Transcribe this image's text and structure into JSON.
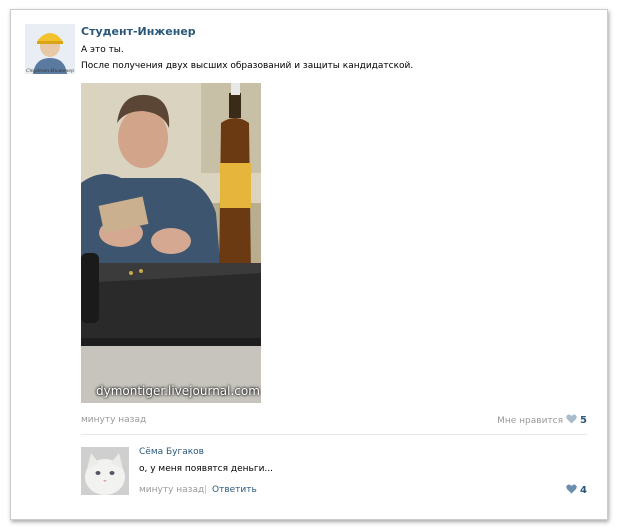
{
  "post": {
    "author": "Студент-Инженер",
    "avatar_caption": "Студент-Инженер",
    "text_line1": "А это ты.",
    "text_line2": "После получения двух высших образований и защиты кандидатской.",
    "photo_watermark": "dymontiger.livejournal.com",
    "time": "минуту назад",
    "like_label": "Мне нравится",
    "like_count": "5",
    "like_icon": "heart-icon"
  },
  "comment": {
    "author": "Сёма Бугаков",
    "text": "о, у меня появятся деньги...",
    "time": "минуту назад",
    "separator": "|",
    "reply_label": "Ответить",
    "like_count": "4",
    "like_icon": "heart-icon"
  },
  "colors": {
    "link": "#2b587a",
    "meta": "#999999",
    "heart_inactive": "#a9bccb",
    "heart_active": "#6b8db0"
  }
}
